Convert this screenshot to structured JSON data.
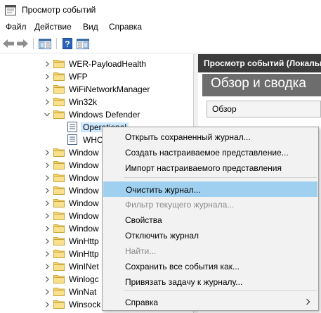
{
  "window": {
    "title": "Просмотр событий"
  },
  "menubar": {
    "items": [
      "Файл",
      "Действие",
      "Вид",
      "Справка"
    ]
  },
  "tree": {
    "items": [
      {
        "label": "WER-PayloadHealth",
        "kind": "folder",
        "expander": "right"
      },
      {
        "label": "WFP",
        "kind": "folder",
        "expander": "right"
      },
      {
        "label": "WiFiNetworkManager",
        "kind": "folder",
        "expander": "right"
      },
      {
        "label": "Win32k",
        "kind": "folder",
        "expander": "right"
      },
      {
        "label": "Windows Defender",
        "kind": "folder",
        "expander": "down"
      },
      {
        "label": "Operational",
        "kind": "log",
        "expander": "none",
        "selected": true
      },
      {
        "label": "WHC",
        "kind": "log",
        "expander": "none"
      },
      {
        "label": "Window",
        "kind": "folder",
        "expander": "right"
      },
      {
        "label": "Window",
        "kind": "folder",
        "expander": "right"
      },
      {
        "label": "Window",
        "kind": "folder",
        "expander": "right"
      },
      {
        "label": "Window",
        "kind": "folder",
        "expander": "right"
      },
      {
        "label": "Window",
        "kind": "folder",
        "expander": "right"
      },
      {
        "label": "Window",
        "kind": "folder",
        "expander": "right"
      },
      {
        "label": "Window",
        "kind": "folder",
        "expander": "right"
      },
      {
        "label": "WinHttp",
        "kind": "folder",
        "expander": "right"
      },
      {
        "label": "WinHttp",
        "kind": "folder",
        "expander": "right"
      },
      {
        "label": "WinINet",
        "kind": "folder",
        "expander": "right"
      },
      {
        "label": "Winlogc",
        "kind": "folder",
        "expander": "right"
      },
      {
        "label": "WinNat",
        "kind": "folder",
        "expander": "right"
      },
      {
        "label": "Winsock",
        "kind": "folder",
        "expander": "right"
      }
    ]
  },
  "right_pane": {
    "header": "Просмотр событий (Локальн",
    "banner": "Обзор и сводка",
    "overview_label": "Обзор"
  },
  "context_menu": {
    "items": [
      {
        "label": "Открыть сохраненный журнал...",
        "state": "enabled"
      },
      {
        "label": "Создать настраиваемое представление...",
        "state": "enabled"
      },
      {
        "label": "Импорт настраиваемого представления",
        "state": "enabled"
      },
      {
        "label": "Очистить журнал...",
        "state": "highlighted"
      },
      {
        "label": "Фильтр текущего журнала...",
        "state": "disabled"
      },
      {
        "label": "Свойства",
        "state": "enabled"
      },
      {
        "label": "Отключить журнал",
        "state": "enabled"
      },
      {
        "label": "Найти...",
        "state": "disabled"
      },
      {
        "label": "Сохранить все события как...",
        "state": "enabled"
      },
      {
        "label": "Привязать задачу к журналу...",
        "state": "enabled"
      },
      {
        "label": "Справка",
        "state": "enabled",
        "submenu": true
      }
    ]
  },
  "colors": {
    "folder": "#f4d46b",
    "highlight": "#9fd0ef",
    "selected": "#cce8ff",
    "header_bg": "#3c3c3c",
    "banner_bg": "#6d6d6d"
  }
}
